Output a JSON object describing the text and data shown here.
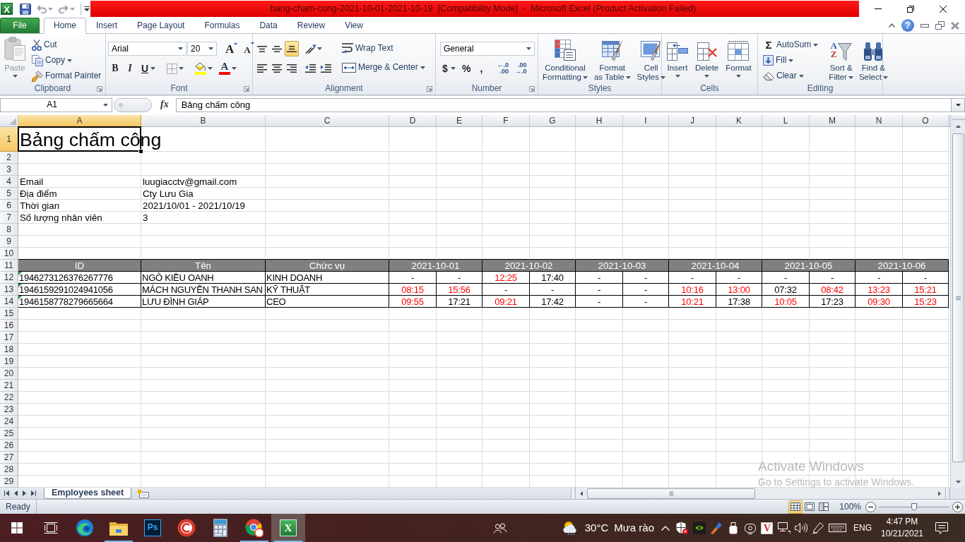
{
  "title_bar": {
    "logo": "X",
    "quick_access": [
      {
        "kind": "save",
        "disabled": false
      },
      {
        "kind": "undo",
        "disabled": true
      },
      {
        "kind": "redo",
        "disabled": true
      }
    ],
    "title": "bang-cham-cong-2021-10-01-2021-10-19  [Compatibility Mode]  -  Microsoft Excel (Product Activation Failed)"
  },
  "ribbon": {
    "tabs": [
      {
        "kind": "backstage",
        "label": "File",
        "selected": false
      },
      {
        "kind": "tab",
        "label": "Home",
        "selected": true
      },
      {
        "kind": "tab",
        "label": "Insert",
        "selected": false
      },
      {
        "kind": "tab",
        "label": "Page Layout",
        "selected": false
      },
      {
        "kind": "tab",
        "label": "Formulas",
        "selected": false
      },
      {
        "kind": "tab",
        "label": "Data",
        "selected": false
      },
      {
        "kind": "tab",
        "label": "Review",
        "selected": false
      },
      {
        "kind": "tab",
        "label": "View",
        "selected": false
      }
    ],
    "help": "?",
    "groups": [
      {
        "label": "Clipboard",
        "launcher": true,
        "sections": [
          {
            "kind": "large",
            "lines": [
              "Paste"
            ],
            "dropdown": true,
            "disabled": true
          },
          {
            "kind": "stack",
            "items": [
              {
                "kind": "small",
                "label": "Cut",
                "disabled": false
              },
              {
                "kind": "small",
                "label": "Copy",
                "dropdown": true,
                "disabled": false
              },
              {
                "kind": "small",
                "label": "Format Painter",
                "disabled": false
              }
            ]
          }
        ]
      },
      {
        "label": "Font",
        "launcher": true,
        "sections": [
          {
            "kind": "rows",
            "rows": [
              [
                [
                  {
                    "kind": "combo",
                    "value": "Arial"
                  },
                  {
                    "kind": "combo",
                    "value": "20"
                  }
                ],
                [
                  {
                    "kind": "grow",
                    "label": "A"
                  },
                  {
                    "kind": "shrink",
                    "label": "A"
                  }
                ]
              ],
              [
                [
                  {
                    "kind": "glyph",
                    "label": "B",
                    "pressed": false
                  },
                  {
                    "kind": "glyph",
                    "label": "I",
                    "pressed": false
                  },
                  {
                    "kind": "glyph",
                    "label": "U",
                    "pressed": false,
                    "dropdown": true
                  }
                ],
                [
                  {
                    "kind": "icon",
                    "dropdown": true
                  }
                ],
                [
                  {
                    "kind": "swatch",
                    "color": "#ffff00",
                    "dropdown": true
                  },
                  {
                    "kind": "swatch",
                    "label": "A",
                    "color": "#ff0000",
                    "dropdown": true
                  }
                ]
              ]
            ]
          }
        ]
      },
      {
        "label": "Alignment",
        "launcher": true,
        "sections": [
          {
            "kind": "rows",
            "rows": [
              [
                [
                  {
                    "kind": "toggle",
                    "pressed": false
                  },
                  {
                    "kind": "toggle",
                    "pressed": false
                  },
                  {
                    "kind": "toggle",
                    "pressed": true
                  }
                ],
                [
                  {
                    "kind": "icon",
                    "dropdown": true
                  }
                ]
              ],
              [
                [
                  {
                    "kind": "toggle",
                    "pressed": false
                  },
                  {
                    "kind": "toggle",
                    "pressed": false
                  },
                  {
                    "kind": "toggle",
                    "pressed": false
                  }
                ],
                [
                  {
                    "kind": "icon"
                  },
                  {
                    "kind": "icon"
                  }
                ]
              ]
            ]
          },
          {
            "kind": "stack",
            "items": [
              {
                "kind": "small",
                "label": "Wrap Text",
                "pressed": false
              },
              {
                "kind": "small",
                "label": "Merge & Center",
                "dropdown": true,
                "pressed": false
              }
            ]
          }
        ]
      },
      {
        "label": "Number",
        "launcher": true,
        "sections": [
          {
            "kind": "rows",
            "rows": [
              [
                [
                  {
                    "kind": "combo",
                    "value": "General"
                  }
                ]
              ],
              [
                [
                  {
                    "kind": "glyph",
                    "label": "$",
                    "dropdown": true
                  },
                  {
                    "kind": "glyph",
                    "label": "%"
                  },
                  {
                    "kind": "glyph",
                    "label": ","
                  }
                ],
                [
                  {
                    "kind": "decimal",
                    "lines": [
                      "←.0",
                      ".00"
                    ]
                  },
                  {
                    "kind": "decimal",
                    "lines": [
                      ".00",
                      "→.0"
                    ]
                  }
                ]
              ]
            ]
          }
        ]
      },
      {
        "label": "Styles",
        "sections": [
          {
            "kind": "large",
            "lines": [
              "Conditional",
              "Formatting"
            ],
            "dropdown": true
          },
          {
            "kind": "large",
            "lines": [
              "Format",
              "as Table"
            ],
            "dropdown": true
          },
          {
            "kind": "large",
            "lines": [
              "Cell",
              "Styles"
            ],
            "dropdown": true
          }
        ]
      },
      {
        "label": "Cells",
        "sections": [
          {
            "kind": "large",
            "lines": [
              "Insert"
            ],
            "dropdown": true
          },
          {
            "kind": "large",
            "lines": [
              "Delete"
            ],
            "dropdown": true
          },
          {
            "kind": "large",
            "lines": [
              "Format"
            ],
            "dropdown": true
          }
        ]
      },
      {
        "label": "Editing",
        "sections": [
          {
            "kind": "stack",
            "items": [
              {
                "kind": "small",
                "glyph": "Σ",
                "label": "AutoSum",
                "dropdown": true
              },
              {
                "kind": "small",
                "label": "Fill",
                "dropdown": true
              },
              {
                "kind": "small",
                "label": "Clear",
                "dropdown": true
              }
            ]
          },
          {
            "kind": "large",
            "glyph": [
              "A",
              "Z"
            ],
            "lines": [
              "Sort &",
              "Filter"
            ],
            "dropdown": true
          },
          {
            "kind": "large",
            "lines": [
              "Find &",
              "Select"
            ],
            "dropdown": true
          }
        ]
      }
    ]
  },
  "formula_bar": {
    "name_box": "A1",
    "function_label": "fx",
    "formula": "Bảng chấm công"
  },
  "sheet": {
    "columns": [
      {
        "label": "A",
        "selected": true
      },
      {
        "label": "B",
        "selected": false
      },
      {
        "label": "C",
        "selected": false
      },
      {
        "label": "D",
        "selected": false
      },
      {
        "label": "E",
        "selected": false
      },
      {
        "label": "F",
        "selected": false
      },
      {
        "label": "G",
        "selected": false
      },
      {
        "label": "H",
        "selected": false
      },
      {
        "label": "I",
        "selected": false
      },
      {
        "label": "J",
        "selected": false
      },
      {
        "label": "K",
        "selected": false
      },
      {
        "label": "L",
        "selected": false
      },
      {
        "label": "M",
        "selected": false
      },
      {
        "label": "N",
        "selected": false
      },
      {
        "label": "O",
        "selected": false
      }
    ],
    "rows": [
      {
        "label": "1",
        "selected": true,
        "kind": "title",
        "cells": [
          {
            "text": "Bảng chấm công"
          }
        ]
      },
      {
        "label": "2",
        "selected": false,
        "kind": "blank"
      },
      {
        "label": "3",
        "selected": false,
        "kind": "blank"
      },
      {
        "label": "4",
        "selected": false,
        "kind": "info",
        "cells": [
          {
            "text": "Email"
          },
          {
            "text": "luugiacctv@gmail.com"
          }
        ]
      },
      {
        "label": "5",
        "selected": false,
        "kind": "info",
        "cells": [
          {
            "text": "Địa điểm"
          },
          {
            "text": "Cty Lưu Gia"
          }
        ]
      },
      {
        "label": "6",
        "selected": false,
        "kind": "info",
        "cells": [
          {
            "text": "Thời gian"
          },
          {
            "text": "2021/10/01 - 2021/10/19"
          }
        ]
      },
      {
        "label": "7",
        "selected": false,
        "kind": "info",
        "cells": [
          {
            "text": "Số lượng nhân viên"
          },
          {
            "text": "3"
          }
        ]
      },
      {
        "label": "8",
        "selected": false,
        "kind": "blank"
      },
      {
        "label": "9",
        "selected": false,
        "kind": "blank"
      },
      {
        "label": "10",
        "selected": false,
        "kind": "blank"
      },
      {
        "label": "11",
        "selected": false,
        "kind": "header",
        "cells": [
          {
            "kind": "field",
            "text": "ID"
          },
          {
            "kind": "field",
            "text": "Tên"
          },
          {
            "kind": "field",
            "text": "Chức vụ"
          },
          {
            "kind": "date",
            "text": "2021-10-01"
          },
          {
            "kind": "date",
            "text": "2021-10-02"
          },
          {
            "kind": "date",
            "text": "2021-10-03"
          },
          {
            "kind": "date",
            "text": "2021-10-04"
          },
          {
            "kind": "date",
            "text": "2021-10-05"
          },
          {
            "kind": "date",
            "text": "2021-10-06"
          }
        ]
      },
      {
        "label": "12",
        "selected": false,
        "kind": "record",
        "cells": [
          {
            "kind": "id",
            "text": "1946273126376267776",
            "warning": true
          },
          {
            "kind": "text",
            "text": "NGÔ KIỀU OANH"
          },
          {
            "kind": "text",
            "text": "KINH DOANH"
          },
          {
            "kind": "time",
            "text": "-",
            "flagged": false
          },
          {
            "kind": "time",
            "text": "-",
            "flagged": false
          },
          {
            "kind": "time",
            "text": "12:25",
            "flagged": true
          },
          {
            "kind": "time",
            "text": "17:40",
            "flagged": false
          },
          {
            "kind": "time",
            "text": "-",
            "flagged": false
          },
          {
            "kind": "time",
            "text": "-",
            "flagged": false
          },
          {
            "kind": "time",
            "text": "-",
            "flagged": false
          },
          {
            "kind": "time",
            "text": "-",
            "flagged": false
          },
          {
            "kind": "time",
            "text": "-",
            "flagged": false
          },
          {
            "kind": "time",
            "text": "-",
            "flagged": false
          },
          {
            "kind": "time",
            "text": "-",
            "flagged": false
          },
          {
            "kind": "time",
            "text": "-",
            "flagged": false
          }
        ]
      },
      {
        "label": "13",
        "selected": false,
        "kind": "record",
        "cells": [
          {
            "kind": "id",
            "text": "1946159291024941056",
            "warning": true
          },
          {
            "kind": "text",
            "text": "MÁCH NGUYỄN THANH SAN"
          },
          {
            "kind": "text",
            "text": "KỸ THUẬT"
          },
          {
            "kind": "time",
            "text": "08:15",
            "flagged": true
          },
          {
            "kind": "time",
            "text": "15:56",
            "flagged": true
          },
          {
            "kind": "time",
            "text": "-",
            "flagged": false
          },
          {
            "kind": "time",
            "text": "-",
            "flagged": false
          },
          {
            "kind": "time",
            "text": "-",
            "flagged": false
          },
          {
            "kind": "time",
            "text": "-",
            "flagged": false
          },
          {
            "kind": "time",
            "text": "10:16",
            "flagged": true
          },
          {
            "kind": "time",
            "text": "13:00",
            "flagged": true
          },
          {
            "kind": "time",
            "text": "07:32",
            "flagged": false
          },
          {
            "kind": "time",
            "text": "08:42",
            "flagged": true
          },
          {
            "kind": "time",
            "text": "13:23",
            "flagged": true
          },
          {
            "kind": "time",
            "text": "15:21",
            "flagged": true
          }
        ]
      },
      {
        "label": "14",
        "selected": false,
        "kind": "record",
        "cells": [
          {
            "kind": "id",
            "text": "1946158778279665664",
            "warning": true
          },
          {
            "kind": "text",
            "text": "LƯU ĐÌNH GIÁP"
          },
          {
            "kind": "text",
            "text": "CEO"
          },
          {
            "kind": "time",
            "text": "09:55",
            "flagged": true
          },
          {
            "kind": "time",
            "text": "17:21",
            "flagged": false
          },
          {
            "kind": "time",
            "text": "09:21",
            "flagged": true
          },
          {
            "kind": "time",
            "text": "17:42",
            "flagged": false
          },
          {
            "kind": "time",
            "text": "-",
            "flagged": false
          },
          {
            "kind": "time",
            "text": "-",
            "flagged": false
          },
          {
            "kind": "time",
            "text": "10:21",
            "flagged": true
          },
          {
            "kind": "time",
            "text": "17:38",
            "flagged": false
          },
          {
            "kind": "time",
            "text": "10:05",
            "flagged": true
          },
          {
            "kind": "time",
            "text": "17:23",
            "flagged": false
          },
          {
            "kind": "time",
            "text": "09:30",
            "flagged": true
          },
          {
            "kind": "time",
            "text": "15:23",
            "flagged": true
          }
        ]
      },
      {
        "label": "15",
        "selected": false,
        "kind": "blank"
      },
      {
        "label": "16",
        "selected": false,
        "kind": "blank"
      },
      {
        "label": "17",
        "selected": false,
        "kind": "blank"
      },
      {
        "label": "18",
        "selected": false,
        "kind": "blank"
      },
      {
        "label": "19",
        "selected": false,
        "kind": "blank"
      },
      {
        "label": "20",
        "selected": false,
        "kind": "blank"
      },
      {
        "label": "21",
        "selected": false,
        "kind": "blank"
      },
      {
        "label": "22",
        "selected": false,
        "kind": "blank"
      },
      {
        "label": "23",
        "selected": false,
        "kind": "blank"
      },
      {
        "label": "24",
        "selected": false,
        "kind": "blank"
      },
      {
        "label": "25",
        "selected": false,
        "kind": "blank"
      },
      {
        "label": "26",
        "selected": false,
        "kind": "blank"
      },
      {
        "label": "27",
        "selected": false,
        "kind": "blank"
      },
      {
        "label": "28",
        "selected": false,
        "kind": "blank"
      },
      {
        "label": "29",
        "selected": false,
        "kind": "blank"
      }
    ]
  },
  "sheet_tabs": [
    {
      "label": "Employees sheet",
      "selected": true
    }
  ],
  "status_bar": {
    "text": "Ready",
    "views": [
      {
        "selected": true
      },
      {
        "selected": false
      },
      {
        "selected": false
      }
    ],
    "zoom": {
      "label": "100%",
      "level": 0.5
    }
  },
  "activation_notice": {
    "title": "Activate Windows",
    "message": "Go to Settings to activate Windows."
  },
  "taskbar": {
    "apps": [
      {
        "kind": "start",
        "selected": false
      },
      {
        "kind": "task_view",
        "selected": false
      },
      {
        "kind": "app",
        "running": false,
        "selected": false
      },
      {
        "kind": "app",
        "running": true,
        "selected": false
      },
      {
        "kind": "app",
        "glyph": "Ps",
        "running": false,
        "selected": false
      },
      {
        "kind": "app",
        "running": false,
        "selected": false
      },
      {
        "kind": "app",
        "running": false,
        "selected": false
      },
      {
        "kind": "app",
        "running": true,
        "selected": false
      },
      {
        "kind": "app",
        "glyph": "X",
        "running": true,
        "selected": true
      }
    ],
    "tray": {
      "temperature": "30°C",
      "weather": "Mưa rào",
      "app_glyph": "V",
      "language": "ENG",
      "time": "4:47 PM",
      "date": "10/21/2021"
    }
  }
}
